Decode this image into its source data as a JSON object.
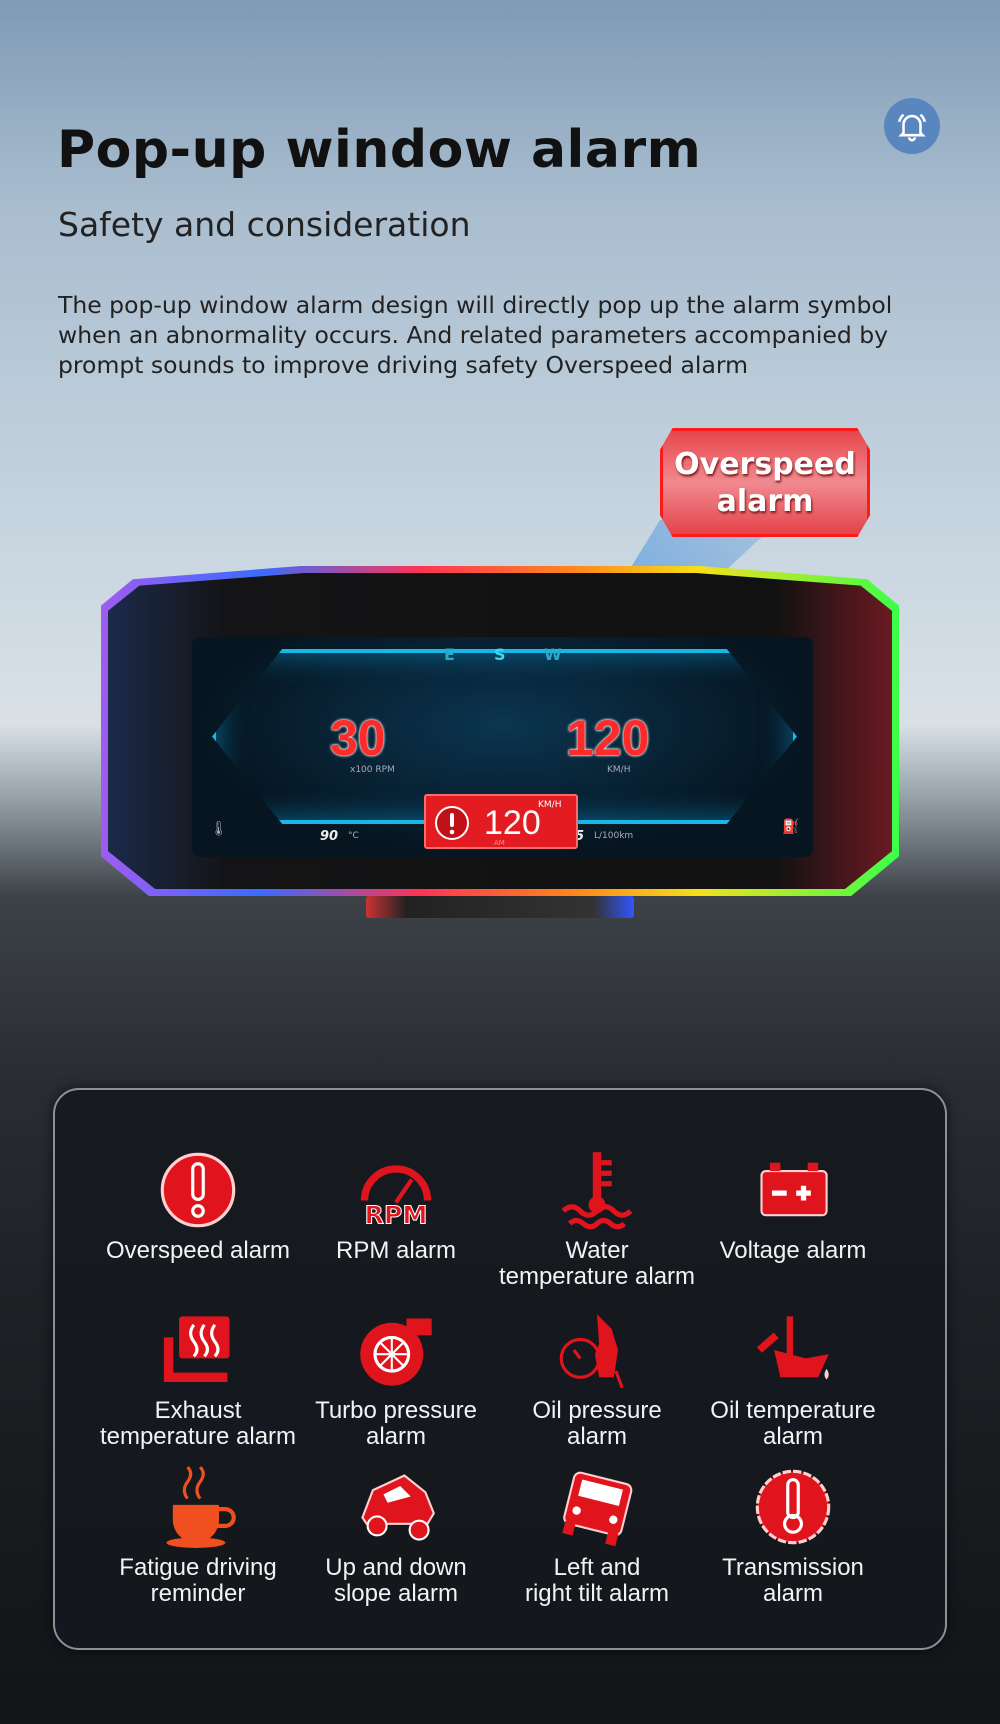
{
  "header": {
    "title": "Pop-up window alarm",
    "subtitle": "Safety and consideration",
    "description": "The pop-up window alarm design will directly pop up the alarm symbol when an abnormality occurs. And related parameters accompanied by prompt sounds to improve driving safety Overspeed alarm",
    "bell_icon": "bell-icon"
  },
  "callout": {
    "label_line1": "Overspeed",
    "label_line2": "alarm"
  },
  "hud": {
    "compass": [
      "E",
      "S",
      "W"
    ],
    "rpm_value": "30",
    "rpm_unit": "x100 RPM",
    "speed_value": "120",
    "speed_unit": "KM/H",
    "alert_speed": "120",
    "alert_unit": "KM/H",
    "alert_ampm": "AM",
    "water_temp": "90",
    "water_temp_unit": "°C",
    "fuel": "26.5",
    "fuel_unit": "L/100km",
    "colors": {
      "accent": "#19b7e6",
      "alarm": "#e31c22"
    }
  },
  "alarms": [
    {
      "label": "Overspeed alarm",
      "icon": "exclamation-icon"
    },
    {
      "label": "RPM alarm",
      "icon": "rpm-gauge-icon"
    },
    {
      "label": "Water\ntemperature alarm",
      "icon": "water-temperature-icon"
    },
    {
      "label": "Voltage alarm",
      "icon": "battery-icon"
    },
    {
      "label": "Exhaust\ntemperature alarm",
      "icon": "exhaust-heat-icon"
    },
    {
      "label": "Turbo pressure\nalarm",
      "icon": "turbo-icon"
    },
    {
      "label": "Oil pressure\nalarm",
      "icon": "fuel-pump-gauge-icon"
    },
    {
      "label": "Oil temperature\nalarm",
      "icon": "oil-can-icon"
    },
    {
      "label": "Fatigue driving\nreminder",
      "icon": "coffee-cup-icon"
    },
    {
      "label": "Up and down\nslope alarm",
      "icon": "car-slope-icon"
    },
    {
      "label": "Left and\nright tilt alarm",
      "icon": "car-tilt-icon"
    },
    {
      "label": "Transmission\nalarm",
      "icon": "transmission-temperature-icon"
    }
  ]
}
